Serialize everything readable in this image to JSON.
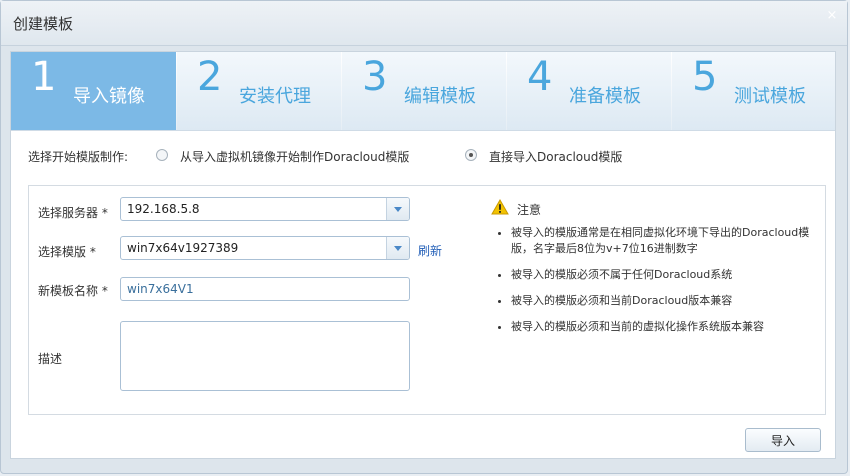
{
  "dialog": {
    "title": "创建模板",
    "close_glyph": "×"
  },
  "steps": [
    {
      "number": "1",
      "label": "导入镜像",
      "active": true
    },
    {
      "number": "2",
      "label": "安装代理",
      "active": false
    },
    {
      "number": "3",
      "label": "编辑模板",
      "active": false
    },
    {
      "number": "4",
      "label": "准备模板",
      "active": false
    },
    {
      "number": "5",
      "label": "测试模板",
      "active": false
    }
  ],
  "mode": {
    "label": "选择开始模版制作:",
    "options": [
      {
        "label": "从导入虚拟机镜像开始制作Doracloud模版",
        "checked": false
      },
      {
        "label": "直接导入Doracloud模版",
        "checked": true
      }
    ]
  },
  "form": {
    "server_label": "选择服务器 *",
    "server_value": "192.168.5.8",
    "template_label": "选择模版 *",
    "template_value": "win7x64v1927389",
    "refresh_label": "刷新",
    "name_label": "新模板名称 *",
    "name_value": "win7x64V1",
    "desc_label": "描述"
  },
  "notice": {
    "title": "注意",
    "items": [
      "被导入的模版通常是在相同虚拟化环境下导出的Doracloud模版，名字最后8位为v+7位16进制数字",
      "被导入的模版必须不属于任何Doracloud系统",
      "被导入的模版必须和当前Doracloud版本兼容",
      "被导入的模版必须和当前的虚拟化操作系统版本兼容"
    ]
  },
  "actions": {
    "import_label": "导入"
  },
  "colors": {
    "accent": "#4aa6dd",
    "active_step": "#7cb9e6",
    "link": "#2460b8",
    "warning": "#f2c200"
  }
}
